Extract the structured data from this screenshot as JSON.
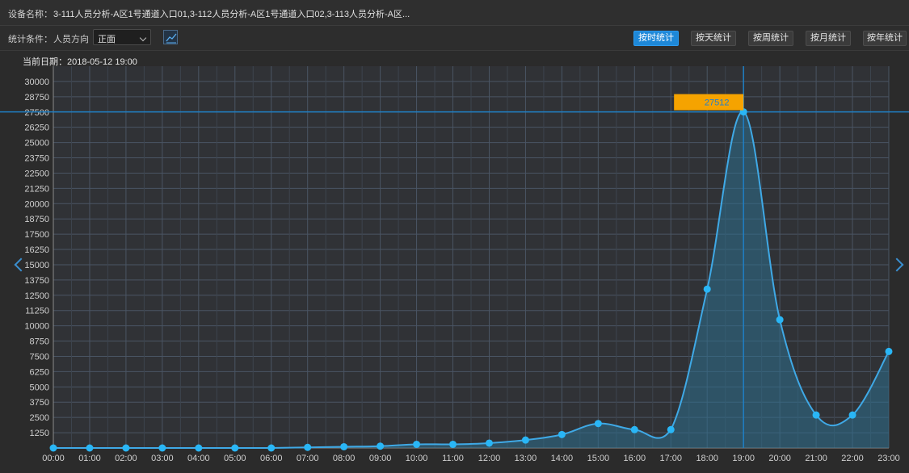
{
  "device": {
    "label": "设备名称：",
    "value": "3-111人员分析-A区1号通道入口01,3-112人员分析-A区1号通道入口02,3-113人员分析-A区..."
  },
  "filter": {
    "label": "统计条件：",
    "direction_label": "人员方向",
    "direction_value": "正面"
  },
  "toolbar": {
    "buttons": [
      {
        "label": "按时统计",
        "active": true
      },
      {
        "label": "按天统计",
        "active": false
      },
      {
        "label": "按周统计",
        "active": false
      },
      {
        "label": "按月统计",
        "active": false
      },
      {
        "label": "按年统计",
        "active": false
      }
    ]
  },
  "current_date": "当前日期：2018-05-12 19:00",
  "tooltip": {
    "value": "27512",
    "color": "#f5a300"
  },
  "colors": {
    "line": "#3fa9e6",
    "point": "#29b6f6",
    "fill": "#2e6f8e",
    "grid": "#4a5564",
    "crosshair": "#1f7fc4"
  },
  "chart_data": {
    "type": "area",
    "categories": [
      "00:00",
      "01:00",
      "02:00",
      "03:00",
      "04:00",
      "05:00",
      "06:00",
      "07:00",
      "08:00",
      "09:00",
      "10:00",
      "11:00",
      "12:00",
      "13:00",
      "14:00",
      "15:00",
      "16:00",
      "17:00",
      "18:00",
      "19:00",
      "20:00",
      "21:00",
      "22:00",
      "23:00"
    ],
    "series": [
      {
        "values": [
          0,
          0,
          0,
          0,
          0,
          0,
          0,
          50,
          100,
          150,
          300,
          300,
          400,
          650,
          1100,
          2000,
          1500,
          1500,
          13000,
          27512,
          10500,
          2700,
          2700,
          7900
        ]
      }
    ],
    "yticks": [
      1250,
      2500,
      3750,
      5000,
      6250,
      7500,
      8750,
      10000,
      11250,
      12500,
      13750,
      15000,
      16250,
      17500,
      18750,
      20000,
      21250,
      22500,
      23750,
      25000,
      26250,
      27500,
      28750,
      30000
    ],
    "ylim": [
      0,
      31250
    ],
    "highlight_index": 19,
    "grid": true
  }
}
